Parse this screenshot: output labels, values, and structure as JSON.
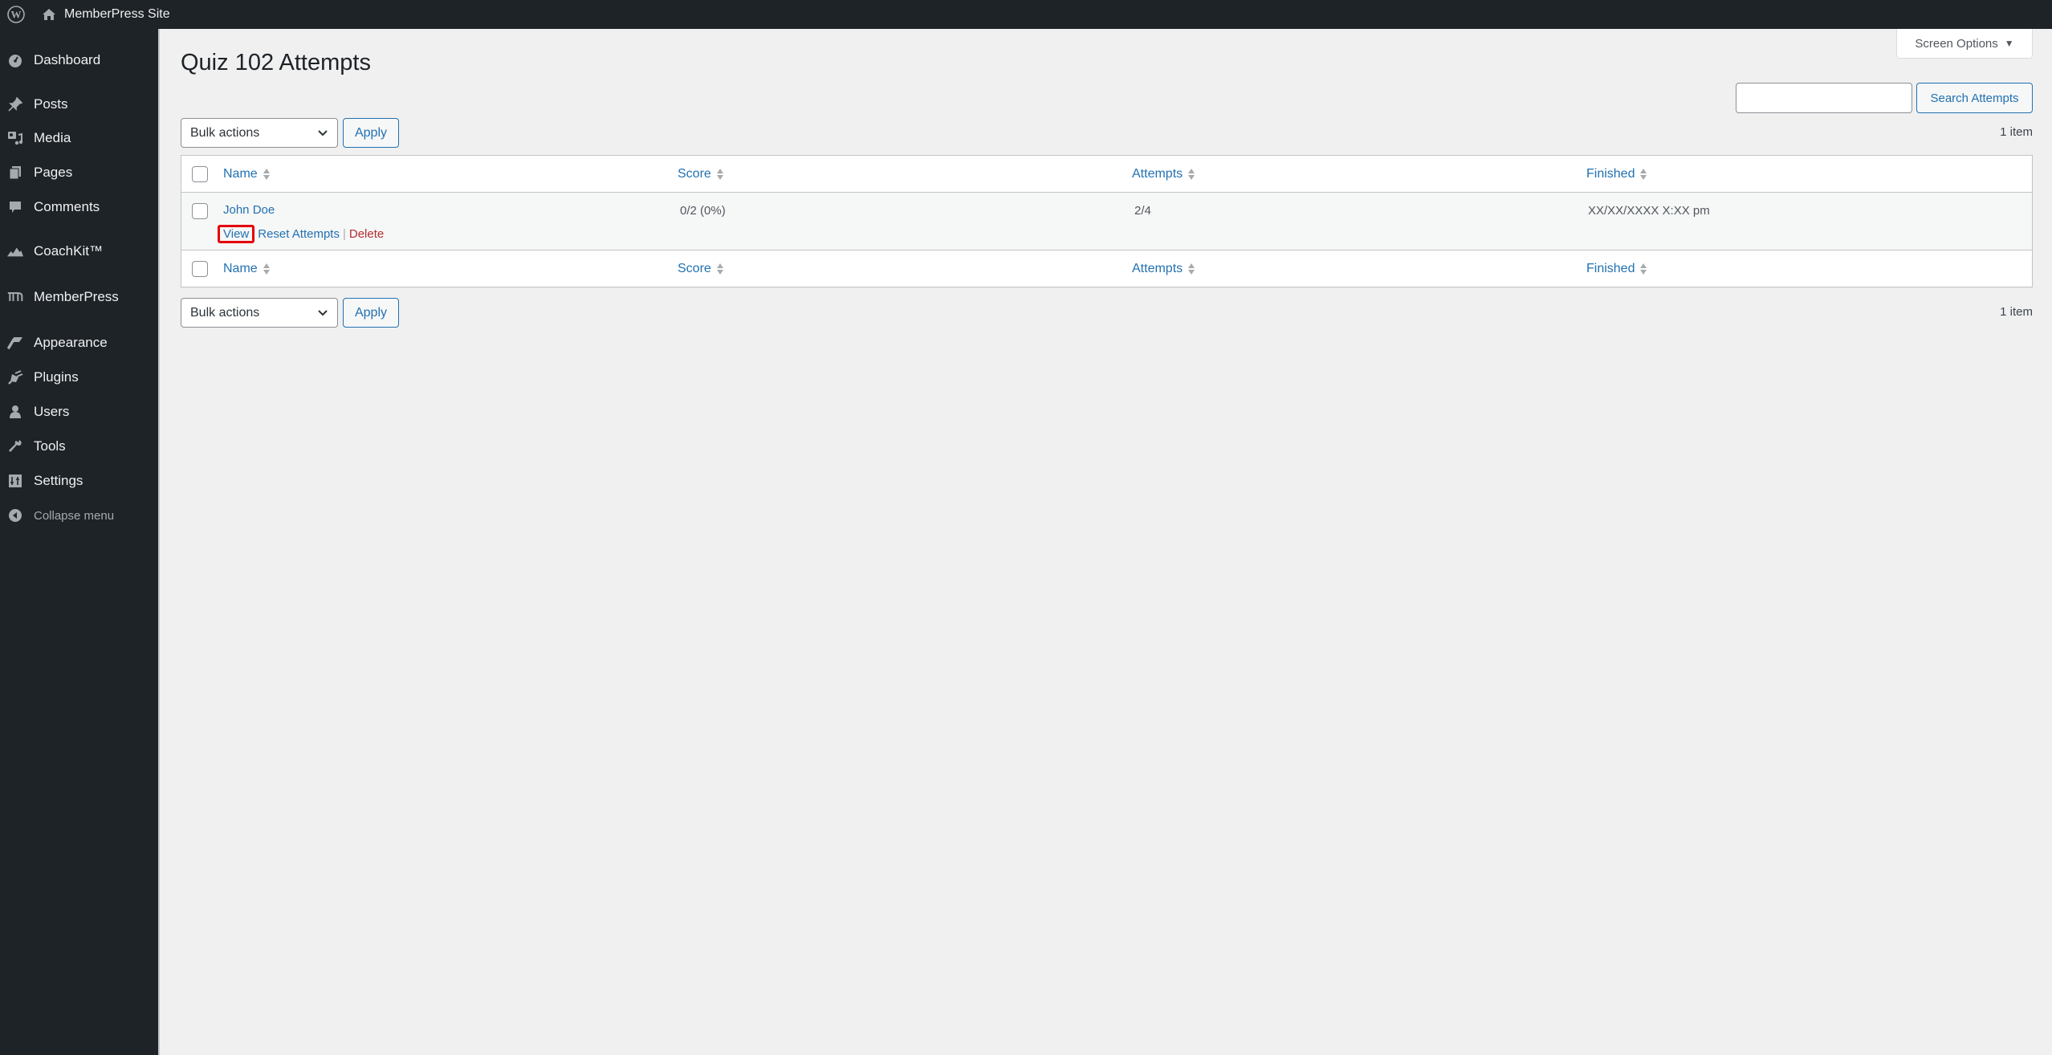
{
  "admin_bar": {
    "site_name": "MemberPress Site"
  },
  "sidebar": {
    "items": [
      {
        "label": "Dashboard",
        "icon": "dashboard-icon"
      },
      {
        "label": "Posts",
        "icon": "pin-icon"
      },
      {
        "label": "Media",
        "icon": "media-icon"
      },
      {
        "label": "Pages",
        "icon": "pages-icon"
      },
      {
        "label": "Comments",
        "icon": "comment-icon"
      },
      {
        "label": "CoachKit™",
        "icon": "mountain-icon"
      },
      {
        "label": "MemberPress",
        "icon": "memberpress-icon"
      },
      {
        "label": "Appearance",
        "icon": "paintbrush-icon"
      },
      {
        "label": "Plugins",
        "icon": "plug-icon"
      },
      {
        "label": "Users",
        "icon": "user-icon"
      },
      {
        "label": "Tools",
        "icon": "wrench-icon"
      },
      {
        "label": "Settings",
        "icon": "settings-icon"
      }
    ],
    "collapse_label": "Collapse menu"
  },
  "page": {
    "title": "Quiz 102 Attempts",
    "screen_options_label": "Screen Options",
    "search": {
      "value": "",
      "placeholder": "",
      "button_label": "Search Attempts"
    },
    "bulk_actions": {
      "selected": "Bulk actions",
      "apply_label": "Apply"
    },
    "item_count": "1 item"
  },
  "table": {
    "columns": [
      "Name",
      "Score",
      "Attempts",
      "Finished"
    ],
    "rows": [
      {
        "name": "John Doe",
        "score": "0/2 (0%)",
        "attempts": "2/4",
        "finished": "XX/XX/XXXX X:XX pm",
        "actions": {
          "view": "View",
          "reset": "Reset Attempts",
          "separator": "|",
          "delete": "Delete"
        }
      }
    ]
  },
  "colors": {
    "admin_dark": "#1d2327",
    "link_blue": "#2271b1",
    "delete_red": "#b32d2e",
    "highlight_red": "#e3000b",
    "page_bg": "#f0f0f1"
  }
}
